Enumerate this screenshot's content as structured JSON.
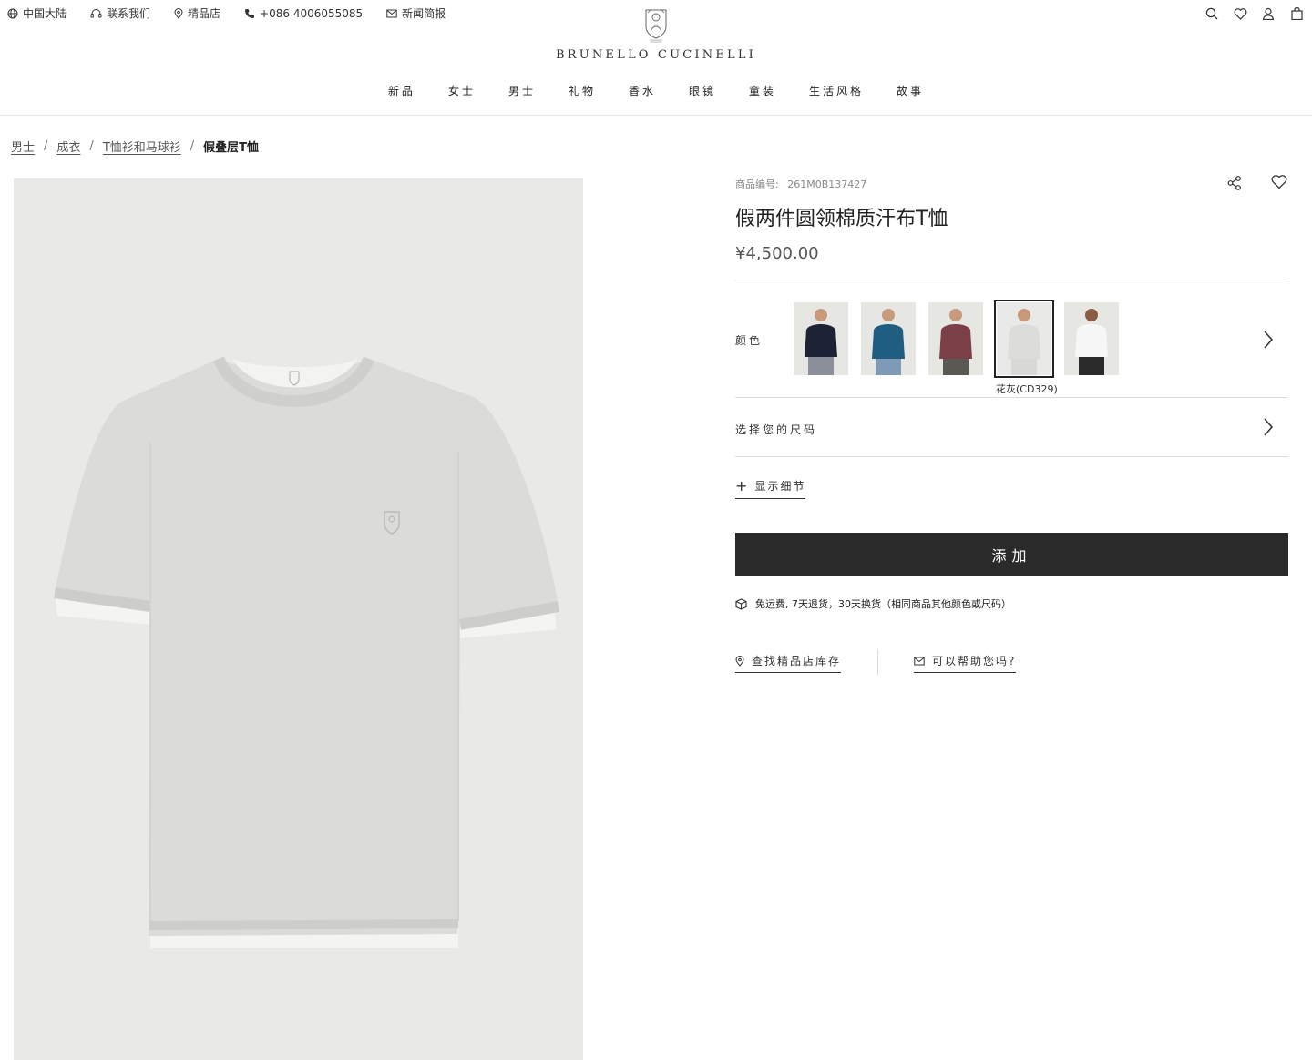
{
  "utility": {
    "region": "中国大陆",
    "contact": "联系我们",
    "stores": "精品店",
    "phone": "+086 4006055085",
    "newsletter": "新闻简报"
  },
  "header_icons": [
    "search-icon",
    "heart-icon",
    "user-icon",
    "bag-icon"
  ],
  "brand": "BRUNELLO CUCINELLI",
  "nav": [
    "新品",
    "女士",
    "男士",
    "礼物",
    "香水",
    "眼镜",
    "童装",
    "生活风格",
    "故事"
  ],
  "breadcrumb": {
    "items": [
      "男士",
      "成衣",
      "T恤衫和马球衫"
    ],
    "current": "假叠层T恤"
  },
  "product": {
    "sku_label": "商品编号:",
    "sku": "261M0B137427",
    "title": "假两件圆领棉质汗布T恤",
    "price": "¥4,500.00",
    "color_label": "颜色",
    "colors": [
      {
        "name": "navy",
        "hex": "#1d2234"
      },
      {
        "name": "teal",
        "hex": "#1f5e80"
      },
      {
        "name": "burgundy",
        "hex": "#7a3f47"
      },
      {
        "name": "花灰(CD329)",
        "hex": "#e6e6e4"
      },
      {
        "name": "white",
        "hex": "#f7f7f7"
      }
    ],
    "selected_color": "花灰(CD329)",
    "size_label": "选择您的尺码",
    "details_label": "显示细节",
    "add_button": "添加",
    "shipping_text": "免运费, 7天退货，30天换货（相同商品其他颜色或尺码）",
    "store_stock": "查找精品店库存",
    "help": "可以帮助您吗?"
  },
  "colors": {
    "button_bg": "#2a2a2a",
    "image_bg": "#e9e9e7",
    "shirt": "#d9d9d7",
    "rule": "#dcdcdc"
  }
}
